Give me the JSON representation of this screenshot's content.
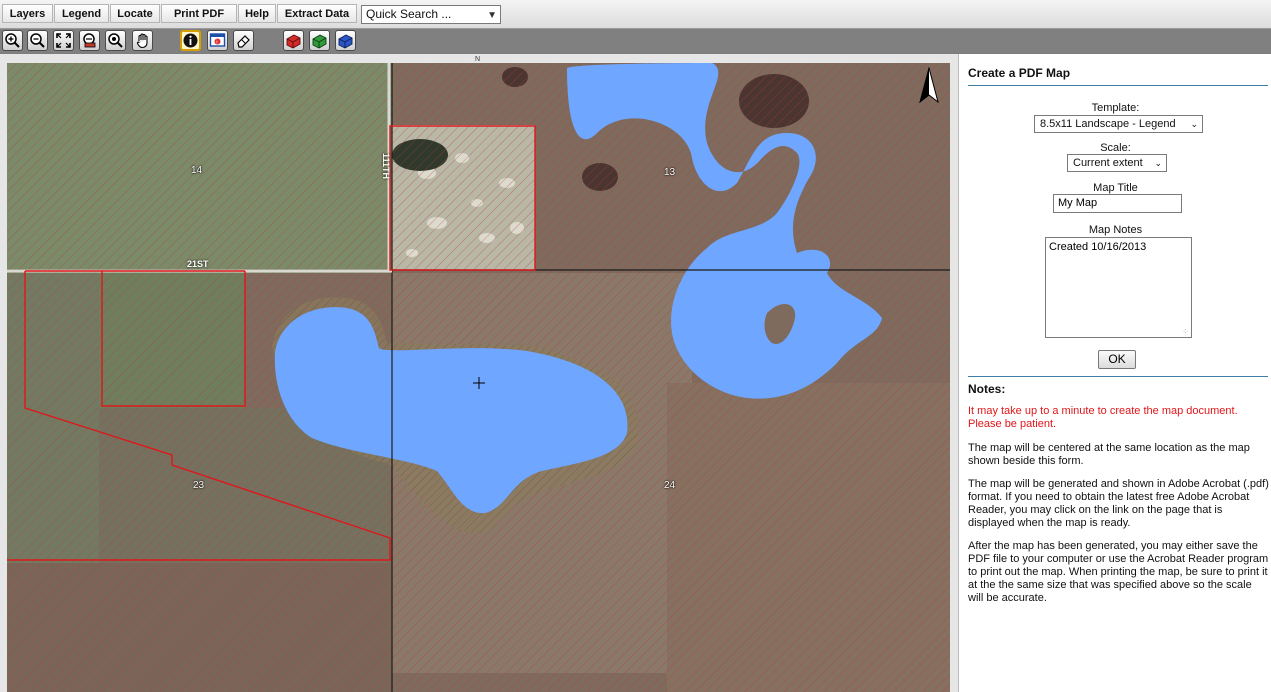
{
  "menu": {
    "items": [
      {
        "label": "Layers"
      },
      {
        "label": "Legend"
      },
      {
        "label": "Locate"
      },
      {
        "label": "Print PDF"
      },
      {
        "label": "Help"
      },
      {
        "label": "Extract Data"
      }
    ],
    "quick_search": "Quick Search ..."
  },
  "toolbar": {
    "tools": [
      "zoom-in-icon",
      "zoom-out-icon",
      "full-extent-icon",
      "zoom-previous-icon",
      "zoom-box-icon",
      "pan-hand-icon",
      "identify-icon",
      "select-info-icon",
      "eraser-icon",
      "layer-red-icon",
      "layer-green-icon",
      "layer-blue-icon"
    ],
    "active_tool": "identify-icon"
  },
  "map": {
    "section_labels": [
      "14",
      "13",
      "23",
      "24"
    ],
    "road_labels": [
      "21ST",
      "111TH"
    ],
    "compass": "N",
    "colors": {
      "water": "#6fa6ff",
      "parcel_outline": "#e0161a",
      "section_line": "#1a1a1a"
    }
  },
  "panel": {
    "title": "Create a PDF Map",
    "template_label": "Template:",
    "template_value": "8.5x11 Landscape - Legend",
    "scale_label": "Scale:",
    "scale_value": "Current extent",
    "map_title_label": "Map Title",
    "map_title_value": "My Map",
    "map_notes_label": "Map Notes",
    "map_notes_value": "Created 10/16/2013",
    "ok_label": "OK",
    "notes_heading": "Notes:",
    "notes": [
      "It may take up to a minute to create the map document. Please be patient.",
      "The map will be centered at the same location as the map shown beside this form.",
      "The map will be generated and shown in Adobe Acrobat (.pdf) format. If you need to obtain the latest free Adobe Acrobat Reader, you may click on the link on the page that is displayed when the map is ready.",
      "After the map has been generated, you may either save the PDF file to your computer or use the Acrobat Reader program to print out the map. When printing the map, be sure to print it at the the same size that was specified above so the scale will be accurate."
    ]
  }
}
